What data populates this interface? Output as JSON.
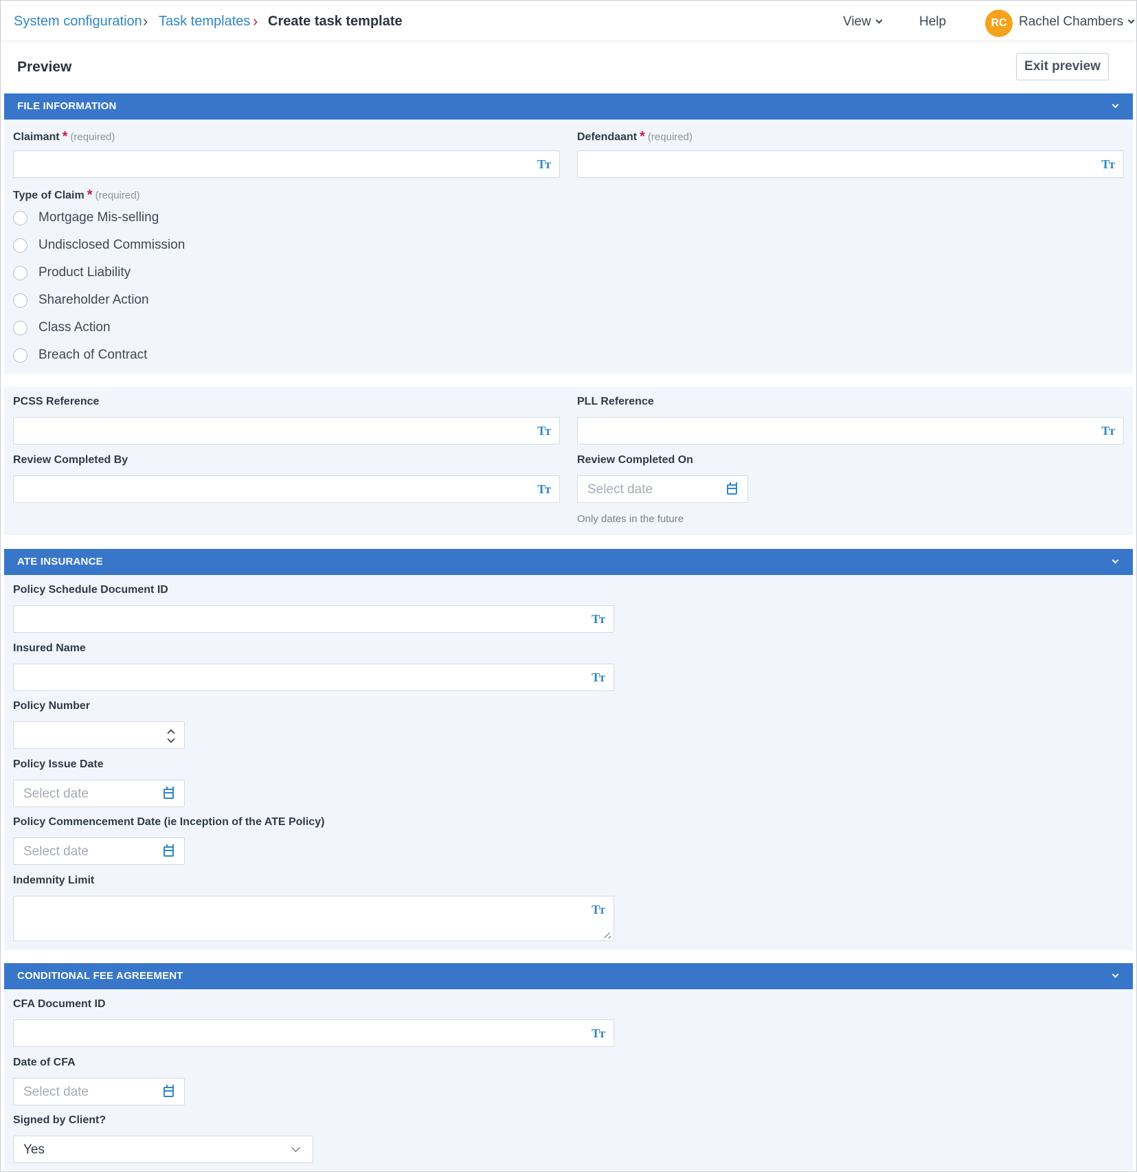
{
  "breadcrumb": {
    "items": [
      "System configuration",
      "Task templates"
    ],
    "current": "Create task template"
  },
  "nav": {
    "view_label": "View",
    "help_label": "Help",
    "user_initials": "RC",
    "user_name": "Rachel Chambers"
  },
  "preview": {
    "title": "Preview",
    "exit_label": "Exit preview"
  },
  "required_text": "(required)",
  "date_placeholder": "Select date",
  "text_icon_glyph": "Tт",
  "colors": {
    "section_bar": "#3876c9",
    "link": "#2f86c6",
    "avatar": "#f7a21c",
    "required_star": "#d0184b",
    "panel_bg": "#f2f6fc"
  },
  "file_information": {
    "title": "FILE INFORMATION",
    "claimant_label": "Claimant",
    "defendant_label": "Defendaant",
    "type_of_claim_label": "Type of Claim",
    "claim_options": [
      "Mortgage Mis-selling",
      "Undisclosed Commission",
      "Product Liability",
      "Shareholder Action",
      "Class Action",
      "Breach of Contract"
    ],
    "pcss_label": "PCSS Reference",
    "pll_label": "PLL Reference",
    "review_by_label": "Review Completed By",
    "review_on_label": "Review Completed On",
    "review_on_hint": "Only dates in the future"
  },
  "ate_insurance": {
    "title": "ATE INSURANCE",
    "policy_doc_label": "Policy Schedule Document ID",
    "insured_name_label": "Insured Name",
    "policy_number_label": "Policy Number",
    "issue_date_label": "Policy Issue Date",
    "commencement_label": "Policy Commencement Date (ie Inception of the ATE Policy)",
    "indemnity_label": "Indemnity Limit"
  },
  "cfa": {
    "title": "CONDITIONAL FEE AGREEMENT",
    "doc_id_label": "CFA Document ID",
    "date_label": "Date of CFA",
    "signed_label": "Signed by Client?",
    "signed_value": "Yes"
  }
}
